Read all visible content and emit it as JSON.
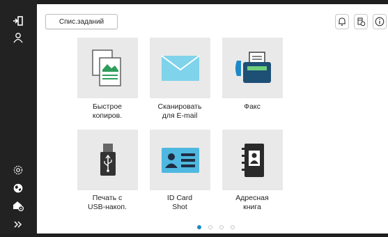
{
  "header": {
    "job_list_label": "Спис.заданий"
  },
  "tiles": [
    {
      "label_line1": "Быстрое",
      "label_line2": "копиров.",
      "icon": "copy-icon"
    },
    {
      "label_line1": "Сканировать",
      "label_line2": "для E-mail",
      "icon": "email-envelope-icon"
    },
    {
      "label_line1": "Факс",
      "label_line2": "",
      "icon": "fax-icon"
    },
    {
      "label_line1": "Печать с",
      "label_line2": "USB-накоп.",
      "icon": "usb-drive-icon"
    },
    {
      "label_line1": "ID Card",
      "label_line2": "Shot",
      "icon": "id-card-icon"
    },
    {
      "label_line1": "Адресная",
      "label_line2": "книга",
      "icon": "address-book-icon"
    }
  ],
  "pagination": {
    "current_page": 1,
    "total_pages": 4
  },
  "sidebar_icons": [
    "logout-icon",
    "user-icon",
    "settings-icon",
    "globe-icon",
    "user-settings-icon",
    "expand-icon"
  ],
  "top_icons": [
    "notification-bell-icon",
    "device-status-icon",
    "info-icon"
  ],
  "colors": {
    "accent": "#1e88c8",
    "sidebar": "#222222",
    "tile_bg": "#e9e9e9",
    "light_blue": "#7fd3ea"
  }
}
